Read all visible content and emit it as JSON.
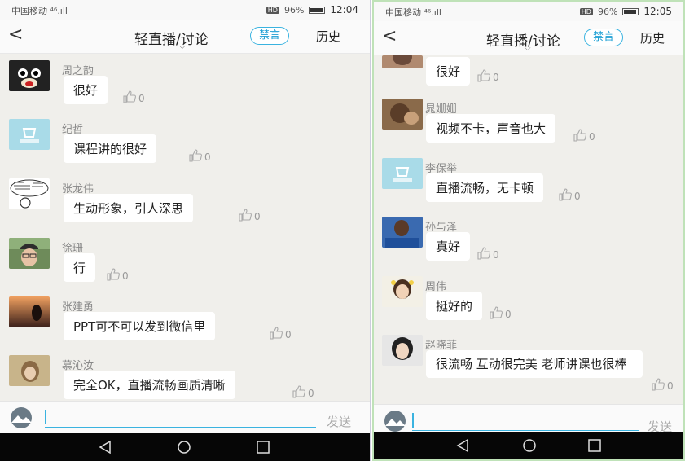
{
  "left_screen": {
    "status": {
      "carrier": "中国移动 ⁴⁶.ıll",
      "hd": "HD",
      "battery": "96%",
      "time": "12:04"
    },
    "title": "轻直播/讨论",
    "mute_label": "禁言",
    "history_label": "历史",
    "messages": [
      {
        "name": "周之韵",
        "text": "很好",
        "likes": "0"
      },
      {
        "name": "纪哲",
        "text": "课程讲的很好",
        "likes": "0"
      },
      {
        "name": "张龙伟",
        "text": "生动形象，引人深思",
        "likes": "0"
      },
      {
        "name": "徐珊",
        "text": "行",
        "likes": "0"
      },
      {
        "name": "张建勇",
        "text": "PPT可不可以发到微信里",
        "likes": "0"
      },
      {
        "name": "慕沁汝",
        "text": "完全OK，直播流畅画质清晰",
        "likes": "0"
      }
    ],
    "send_label": "发送"
  },
  "right_screen": {
    "status": {
      "carrier": "中国移动 ⁴⁶.ıll",
      "hd": "HD",
      "battery": "96%",
      "time": "12:05"
    },
    "title": "轻直播/讨论",
    "mute_label": "禁言",
    "history_label": "历史",
    "partial_message": {
      "text": "很好",
      "likes": "0"
    },
    "messages": [
      {
        "name": "晁姗姗",
        "text": "视频不卡，声音也大",
        "likes": "0"
      },
      {
        "name": "李保举",
        "text": "直播流畅，无卡顿",
        "likes": "0"
      },
      {
        "name": "孙与泽",
        "text": "真好",
        "likes": "0"
      },
      {
        "name": "周伟",
        "text": "挺好的",
        "likes": "0"
      },
      {
        "name": "赵晓菲",
        "text": "很流畅 互动很完美 老师讲课也很棒",
        "likes": "0"
      }
    ],
    "send_label": "发送"
  },
  "colors": {
    "accent": "#3ab3e0",
    "background": "#f0efeb",
    "bubble": "#ffffff",
    "navbar": "#060606"
  },
  "icons": [
    "back-icon",
    "thumb-up-icon",
    "back-triangle-icon",
    "home-circle-icon",
    "recent-square-icon",
    "wifi-icon",
    "battery-icon"
  ]
}
